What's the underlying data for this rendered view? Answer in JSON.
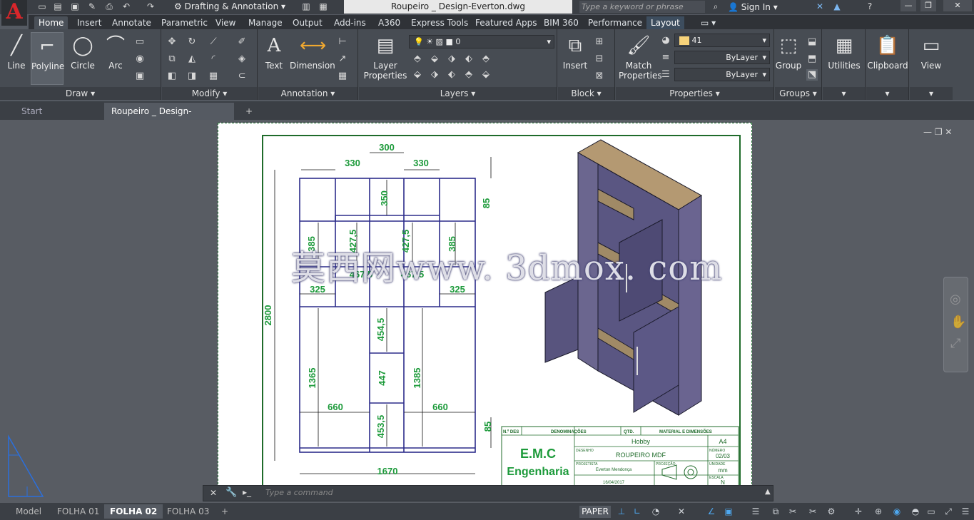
{
  "app": {
    "logo_letter": "A",
    "title": "Roupeiro _ Design-Everton.dwg",
    "workspace": "Drafting & Annotation",
    "search_placeholder": "Type a keyword or phrase",
    "signin": "Sign In"
  },
  "ribbon_tabs": [
    "Home",
    "Insert",
    "Annotate",
    "Parametric",
    "View",
    "Manage",
    "Output",
    "Add-ins",
    "A360",
    "Express Tools",
    "Featured Apps",
    "BIM 360",
    "Performance",
    "Layout"
  ],
  "panels": {
    "draw": "Draw",
    "modify": "Modify",
    "annotation": "Annotation",
    "layers": "Layers",
    "block": "Block",
    "properties": "Properties",
    "groups": "Groups"
  },
  "buttons": {
    "line": "Line",
    "polyline": "Polyline",
    "circle": "Circle",
    "arc": "Arc",
    "text": "Text",
    "dimension": "Dimension",
    "layer_properties": "Layer\nProperties",
    "insert": "Insert",
    "match_properties": "Match\nProperties",
    "group": "Group",
    "utilities": "Utilities",
    "clipboard": "Clipboard",
    "view": "View"
  },
  "layer_current": "0",
  "color_current": "41",
  "linetype_current": "ByLayer",
  "lineweight_current": "ByLayer",
  "doc_tabs": [
    "Start",
    "Roupeiro _ Design-Everton*"
  ],
  "drawing": {
    "dims": [
      "300",
      "330",
      "330",
      "85",
      "350",
      "385",
      "427,5",
      "427,5",
      "385",
      "467,5",
      "467,5",
      "325",
      "325",
      "2800",
      "454,5",
      "1365",
      "447",
      "1385",
      "660",
      "660",
      "453,5",
      "85",
      "1670"
    ],
    "title_block": {
      "h_code": "N.º DES",
      "h_denom": "DENOMINAÇÕES",
      "h_qtd": "QTD.",
      "h_mat": "MATERIAL E DIMENSÕES",
      "company1": "E.M.C",
      "company2": "Engenharia",
      "item": "Hobby",
      "size": "A4",
      "desenho": "DESENHO",
      "titulo": "ROUPEIRO MDF",
      "numero": "NÚMERO",
      "numero_val": "02/03",
      "projetista": "PROJETISTA",
      "projetista_val": "Everton Mendonça",
      "projecao": "PROJEÇÃO",
      "unidade": "UNIDADE",
      "unidade_val": "mm",
      "data": "16/04/2017",
      "escala": "ESCALA",
      "escala_val": "N"
    }
  },
  "watermark": "莫西网www. 3dmox. com",
  "command_placeholder": "Type a command",
  "layout_tabs": [
    "Model",
    "FOLHA 01",
    "FOLHA 02",
    "FOLHA 03"
  ],
  "status_mode": "PAPER"
}
